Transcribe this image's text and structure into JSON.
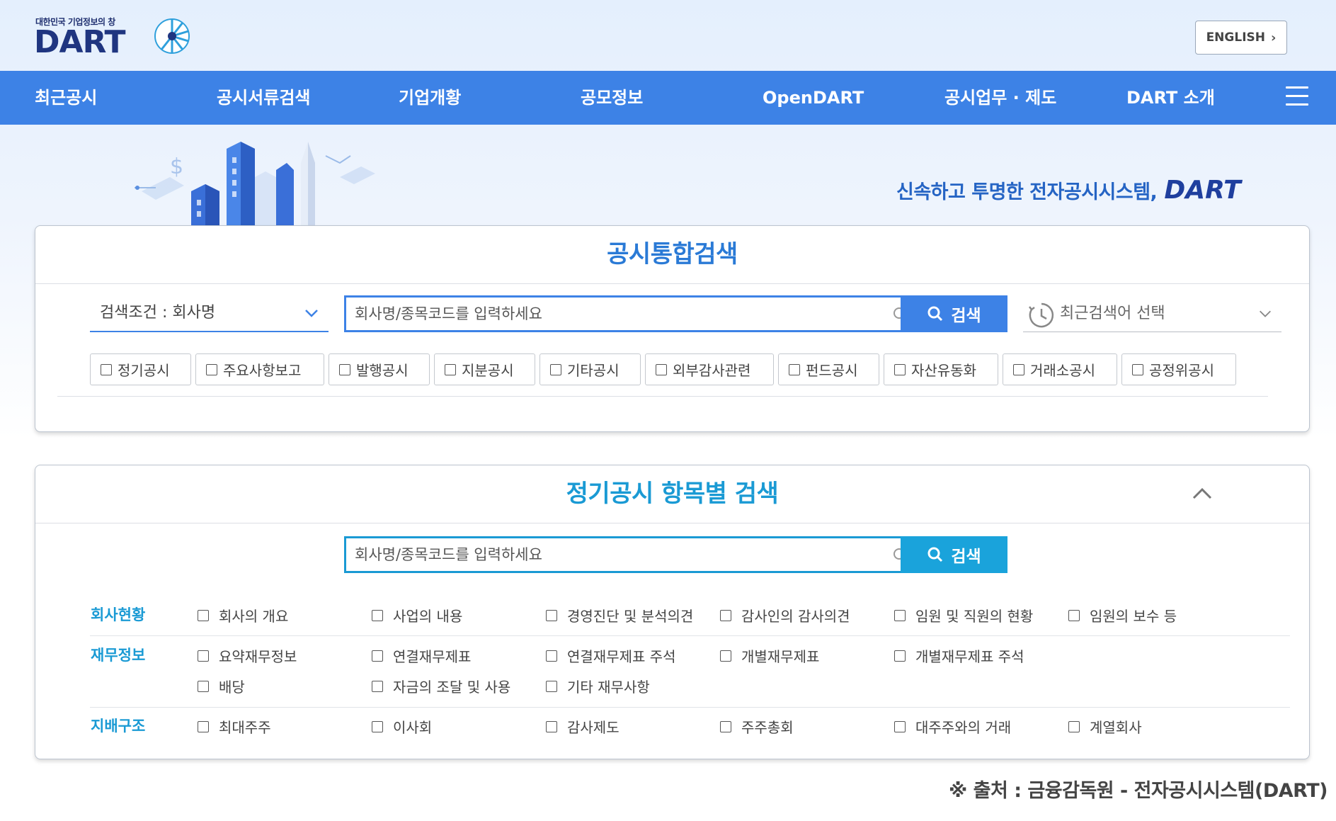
{
  "header": {
    "logo_tagline": "대한민국 기업정보의 창",
    "logo_text": "DART",
    "english_label": "ENGLISH"
  },
  "nav": {
    "items": [
      "최근공시",
      "공시서류검색",
      "기업개황",
      "공모정보",
      "OpenDART",
      "공시업무 · 제도",
      "DART 소개"
    ]
  },
  "hero": {
    "slogan": "신속하고 투명한 전자공시시스템,",
    "slogan_brand": "DART"
  },
  "integrated_search": {
    "title": "공시통합검색",
    "condition_label": "검색조건 : 회사명",
    "input_placeholder": "회사명/종목코드를 입력하세요",
    "search_label": "검색",
    "recent_label": "최근검색어 선택",
    "chips": [
      "정기공시",
      "주요사항보고",
      "발행공시",
      "지분공시",
      "기타공시",
      "외부감사관련",
      "펀드공시",
      "자산유동화",
      "거래소공시",
      "공정위공시"
    ]
  },
  "periodic_search": {
    "title": "정기공시 항목별 검색",
    "input_placeholder": "회사명/종목코드를 입력하세요",
    "search_label": "검색",
    "categories": [
      {
        "label": "회사현황",
        "items": [
          "회사의 개요",
          "사업의 내용",
          "경영진단 및 분석의견",
          "감사인의 감사의견",
          "임원 및 직원의 현황",
          "임원의 보수 등"
        ]
      },
      {
        "label": "재무정보",
        "items": [
          "요약재무정보",
          "연결재무제표",
          "연결재무제표 주석",
          "개별재무제표",
          "개별재무제표 주석",
          "배당",
          "자금의 조달 및 사용",
          "기타 재무사항"
        ]
      },
      {
        "label": "지배구조",
        "items": [
          "최대주주",
          "이사회",
          "감사제도",
          "주주총회",
          "대주주와의 거래",
          "계열회사"
        ]
      }
    ]
  },
  "footer": {
    "source": "※ 출처 : 금융감독원 - 전자공시시스템(DART)"
  },
  "colors": {
    "nav_blue": "#3d82e6",
    "title_blue": "#2a7ad6",
    "teal": "#1a9ad4"
  }
}
